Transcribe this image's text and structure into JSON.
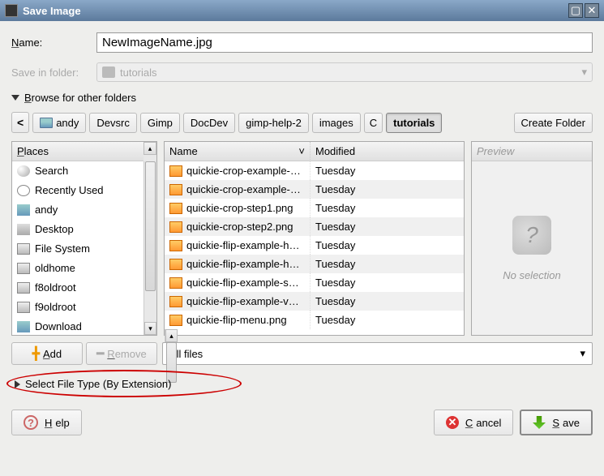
{
  "titlebar": {
    "title": "Save Image"
  },
  "name": {
    "label_pre": "N",
    "label_rest": "ame:",
    "value": "NewImageName.jpg"
  },
  "save_in": {
    "label": "Save in folder:",
    "value": "tutorials"
  },
  "browse": {
    "pre": "B",
    "rest": "rowse for other folders"
  },
  "path": {
    "nav_left": "<",
    "segments": [
      {
        "label": "andy",
        "icon": true
      },
      {
        "label": "Devsrc"
      },
      {
        "label": "Gimp"
      },
      {
        "label": "DocDev"
      },
      {
        "label": "gimp-help-2"
      },
      {
        "label": "images"
      },
      {
        "label": "C"
      },
      {
        "label": "tutorials",
        "active": true
      }
    ],
    "create_folder": "Create Folder"
  },
  "places": {
    "header_pre": "P",
    "header_rest": "laces",
    "items": [
      {
        "icon": "srch-i",
        "label": "Search"
      },
      {
        "icon": "clock-i",
        "label": "Recently Used"
      },
      {
        "icon": "home-i",
        "label": "andy"
      },
      {
        "icon": "desk-i",
        "label": "Desktop"
      },
      {
        "icon": "drive-i",
        "label": "File System"
      },
      {
        "icon": "drive-i",
        "label": "oldhome"
      },
      {
        "icon": "drive-i",
        "label": "f8oldroot"
      },
      {
        "icon": "drive-i",
        "label": "f9oldroot"
      },
      {
        "icon": "home-i",
        "label": "Download"
      }
    ]
  },
  "files": {
    "name_header": "Name",
    "mod_header": "Modified",
    "rows": [
      {
        "name": "quickie-crop-example-…",
        "mod": "Tuesday"
      },
      {
        "name": "quickie-crop-example-…",
        "mod": "Tuesday",
        "alt": true
      },
      {
        "name": "quickie-crop-step1.png",
        "mod": "Tuesday"
      },
      {
        "name": "quickie-crop-step2.png",
        "mod": "Tuesday",
        "alt": true
      },
      {
        "name": "quickie-flip-example-h…",
        "mod": "Tuesday"
      },
      {
        "name": "quickie-flip-example-h…",
        "mod": "Tuesday",
        "alt": true
      },
      {
        "name": "quickie-flip-example-s…",
        "mod": "Tuesday"
      },
      {
        "name": "quickie-flip-example-v…",
        "mod": "Tuesday",
        "alt": true
      },
      {
        "name": "quickie-flip-menu.png",
        "mod": "Tuesday"
      }
    ]
  },
  "preview": {
    "header": "Preview",
    "text": "No selection"
  },
  "add": "Add",
  "remove": "Remove",
  "all_files": "All files",
  "select_type": "Select File Type (By Extension)",
  "footer": {
    "help_pre": "H",
    "help_rest": "elp",
    "cancel_pre": "C",
    "cancel_rest": "ancel",
    "save_pre": "S",
    "save_rest": "ave"
  }
}
